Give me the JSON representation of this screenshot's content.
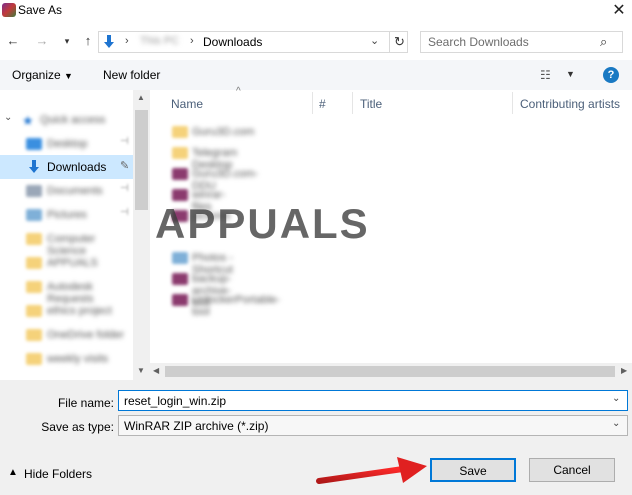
{
  "window": {
    "title": "Save As"
  },
  "address_bar": {
    "path": [
      "This PC",
      "Downloads"
    ],
    "search_placeholder": "Search Downloads"
  },
  "toolbar": {
    "organize_label": "Organize",
    "new_folder_label": "New folder"
  },
  "nav_pane": {
    "items": [
      {
        "label": "Quick access",
        "blurred": true
      },
      {
        "label": "Desktop",
        "blurred": true
      },
      {
        "label": "Downloads",
        "blurred": false,
        "selected": true
      },
      {
        "label": "Documents",
        "blurred": true
      },
      {
        "label": "Pictures",
        "blurred": true
      },
      {
        "label": "Computer Science",
        "blurred": true
      },
      {
        "label": "APPUALS",
        "blurred": true
      },
      {
        "label": "Autodesk Requests",
        "blurred": true
      },
      {
        "label": "ethics project",
        "blurred": true
      },
      {
        "label": "OneDrive folder",
        "blurred": true
      },
      {
        "label": "weekly visits",
        "blurred": true
      }
    ]
  },
  "file_list": {
    "columns": [
      "Name",
      "#",
      "Title",
      "Contributing artists"
    ],
    "rows": [
      {
        "name": "Guru3D.com",
        "type": "folder"
      },
      {
        "name": "Telegram Desktop",
        "type": "folder"
      },
      {
        "name": "Guru3D.com-DDU",
        "type": "archive"
      },
      {
        "name": "winrar-files",
        "type": "archive"
      },
      {
        "name": "pictures",
        "type": "archive"
      },
      {
        "name": "Photos - Shortcut",
        "type": "shortcut"
      },
      {
        "name": "backup-archive-tool",
        "type": "archive"
      },
      {
        "name": "UnlockerPortable-tool",
        "type": "archive"
      }
    ],
    "watermark": "APPUALS"
  },
  "form": {
    "file_name_label": "File name:",
    "file_name_value": "reset_login_win.zip",
    "save_type_label": "Save as type:",
    "save_type_value": "WinRAR ZIP archive (*.zip)"
  },
  "footer": {
    "hide_folders_label": "Hide Folders",
    "save_label": "Save",
    "cancel_label": "Cancel"
  },
  "colors": {
    "accent": "#0078d7",
    "selection": "#cce8ff",
    "annotation_arrow": "#e02020"
  }
}
